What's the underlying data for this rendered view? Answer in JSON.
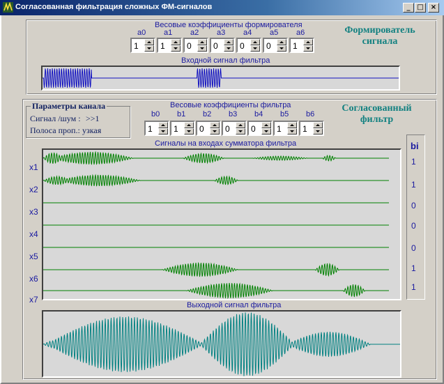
{
  "window": {
    "title": "Согласованная фильтрация сложных ФМ-сигналов",
    "buttons": {
      "minimize": "_",
      "maximize": "□",
      "close": "×"
    }
  },
  "shaper": {
    "weights_caption": "Весовые коэффициенты формирователя",
    "labels": [
      "a0",
      "a1",
      "a2",
      "a3",
      "a4",
      "a5",
      "a6"
    ],
    "values": [
      "1",
      "1",
      "0",
      "0",
      "0",
      "0",
      "1"
    ],
    "title": "Формирователь сигнала",
    "input_signal_caption": "Входной сигнал фильтра"
  },
  "channel": {
    "legend": "Параметры канала",
    "snr_label": "Сигнал /шум :",
    "snr_value": ">>1",
    "band_label": "Полоса проп.:",
    "band_value": "узкая"
  },
  "filter": {
    "weights_caption": "Весовые коэффициенты фильтра",
    "labels": [
      "b0",
      "b1",
      "b2",
      "b3",
      "b4",
      "b5",
      "b6"
    ],
    "values": [
      "1",
      "1",
      "0",
      "0",
      "0",
      "1",
      "1"
    ],
    "title": "Согласованный фильтр",
    "summator_caption": "Сигналы на входах сумматора фильтра",
    "channel_labels": [
      "x1",
      "x2",
      "x3",
      "x4",
      "x5",
      "x6",
      "x7"
    ],
    "bi_header": "bi",
    "bi_values": [
      "1",
      "1",
      "0",
      "0",
      "0",
      "1",
      "1"
    ],
    "output_caption": "Выходной сигнал фильтра"
  },
  "colors": {
    "input_trace": "#1010c0",
    "channel_trace": "#008000",
    "output_trace": "#008080",
    "plot_bg": "#d8d8d8",
    "window_face": "#d4d0c8"
  },
  "icons": {
    "app": "app-icon"
  }
}
